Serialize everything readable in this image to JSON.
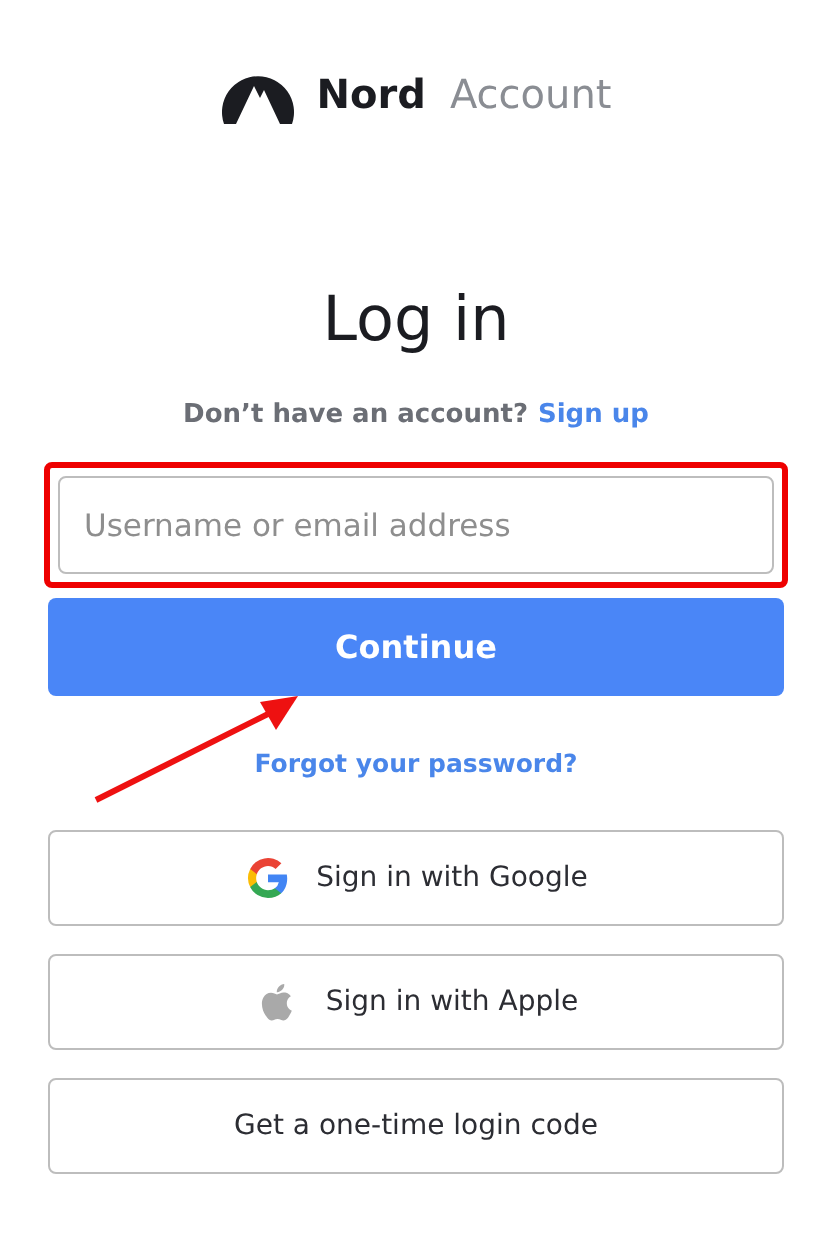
{
  "brand": {
    "name": "Nord",
    "product": "Account"
  },
  "heading": "Log in",
  "signup": {
    "prompt": "Don’t have an account?",
    "link": "Sign up"
  },
  "username": {
    "placeholder": "Username or email address",
    "highlighted": true
  },
  "continue_button": "Continue",
  "arrow_to_continue": true,
  "forgot_link": "Forgot your password?",
  "alt_buttons": [
    {
      "kind": "google",
      "label": "Sign in with Google"
    },
    {
      "kind": "apple",
      "label": "Sign in with Apple"
    },
    {
      "kind": "plain",
      "label": "Get a one-time login code"
    }
  ]
}
